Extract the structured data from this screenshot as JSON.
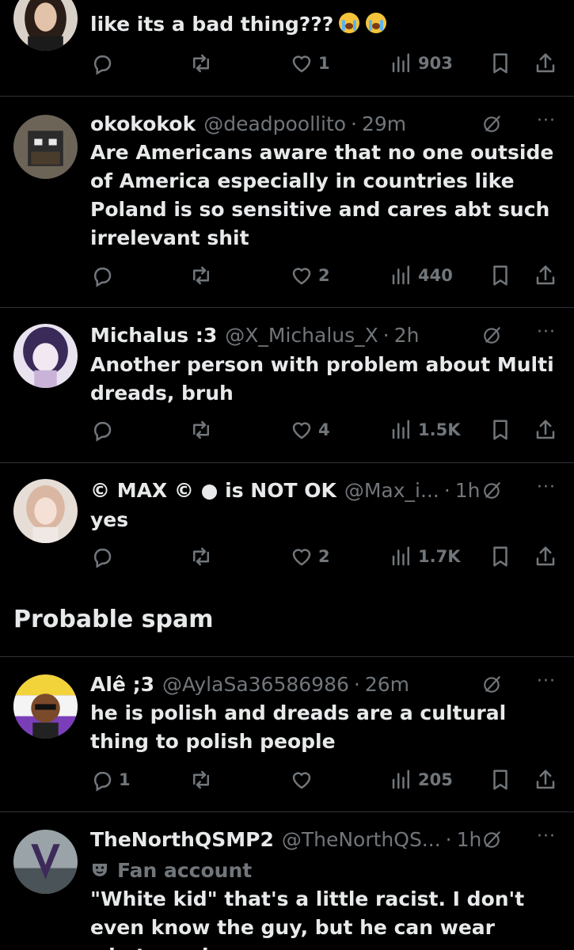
{
  "posts": [
    {
      "username": "",
      "handle": "",
      "time": "",
      "text": "like its a bad thing???",
      "emojis": [
        "loudly-crying-face",
        "loudly-crying-face"
      ],
      "replies": "",
      "reposts": "",
      "likes": "1",
      "views": "903"
    },
    {
      "username": "okokokok",
      "handle": "@deadpoollito",
      "time": "29m",
      "text": "Are Americans aware that no one outside of America especially in countries like Poland is so sensitive and cares abt such irrelevant shit",
      "replies": "",
      "reposts": "",
      "likes": "2",
      "views": "440"
    },
    {
      "username": "Michalus :3",
      "handle": "@X_Michalus_X",
      "time": "2h",
      "text": "Another person with problem about Multi dreads, bruh",
      "replies": "",
      "reposts": "",
      "likes": "4",
      "views": "1.5K"
    },
    {
      "username": "© MAX © ● is NOT OK",
      "handle": "@Max_i...",
      "time": "1h",
      "text": "yes",
      "replies": "",
      "reposts": "",
      "likes": "2",
      "views": "1.7K"
    }
  ],
  "section": {
    "title": "Probable spam"
  },
  "spam_posts": [
    {
      "username": "Alê ;3",
      "handle": "@AylaSa36586986",
      "time": "26m",
      "text": "he is polish and dreads are a cultural thing to polish people",
      "replies": "1",
      "reposts": "",
      "likes": "",
      "views": "205"
    },
    {
      "username": "TheNorthQSMP2",
      "handle": "@TheNorthQS...",
      "time": "1h",
      "badge": "Fan account",
      "text": "\"White kid\" that's a little racist. I don't even know the guy, but he can wear whatever he"
    }
  ],
  "separator": "·",
  "more_glyph": "···",
  "colors": {
    "background": "#000000",
    "text": "#e7e9ea",
    "muted": "#71767b",
    "border": "#2f3336"
  }
}
